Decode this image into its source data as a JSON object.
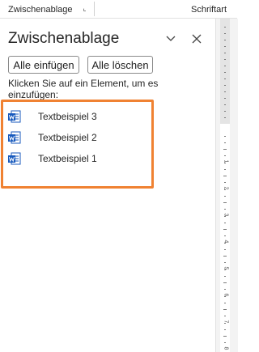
{
  "ribbon": {
    "clipboard_group": "Zwischenablage",
    "font_group": "Schriftart"
  },
  "pane": {
    "title": "Zwischenablage",
    "paste_all": "Alle einfügen",
    "clear_all": "Alle löschen",
    "hint": "Klicken Sie auf ein Element, um es einzufügen:",
    "items": [
      {
        "label": "Textbeispiel 3",
        "icon": "word-document-icon"
      },
      {
        "label": "Textbeispiel 2",
        "icon": "word-document-icon"
      },
      {
        "label": "Textbeispiel 1",
        "icon": "word-document-icon"
      }
    ]
  },
  "ruler": {
    "numbers": [
      "1",
      "2",
      "3",
      "4",
      "5",
      "6",
      "7",
      "8"
    ]
  },
  "colors": {
    "highlight": "#f08232",
    "word_blue": "#185abd"
  }
}
